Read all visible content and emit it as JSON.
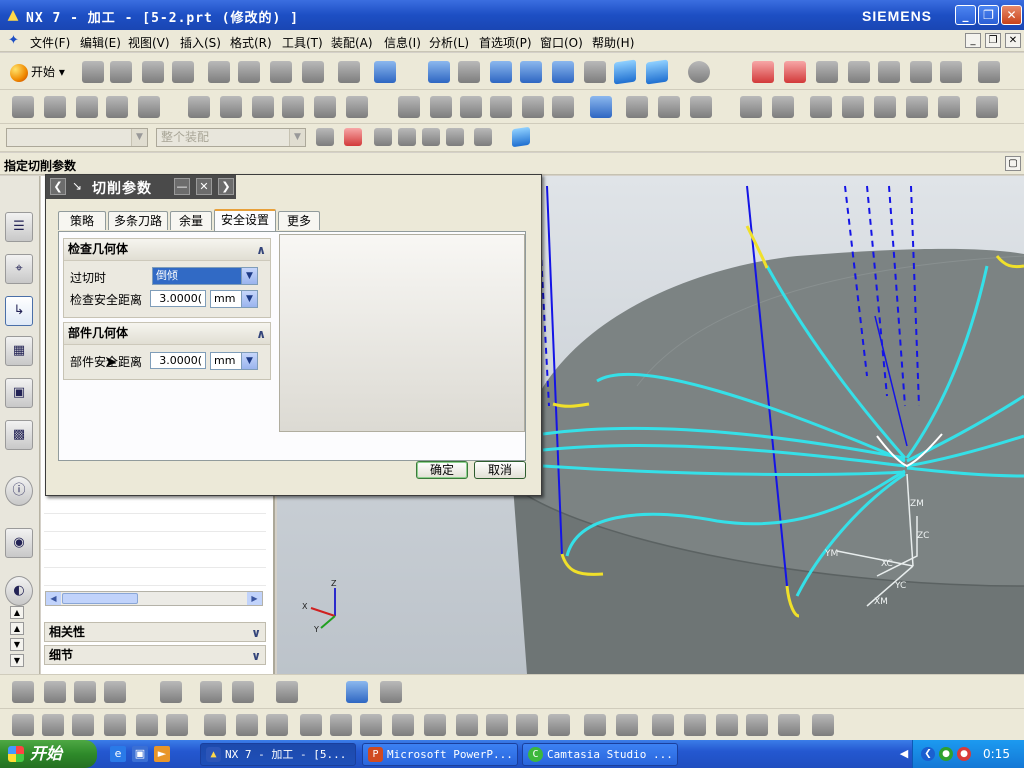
{
  "window": {
    "title": "NX 7 - 加工 - [5-2.prt (修改的) ]",
    "brand": "SIEMENS"
  },
  "menu": {
    "items": [
      "文件(F)",
      "编辑(E)",
      "视图(V)",
      "插入(S)",
      "格式(R)",
      "工具(T)",
      "装配(A)",
      "信息(I)",
      "分析(L)",
      "首选项(P)",
      "窗口(O)",
      "帮助(H)"
    ]
  },
  "toolbar": {
    "start_label": "开始",
    "filter_value": "",
    "assembly_filter": "整个装配"
  },
  "cue_line": "指定切削参数",
  "navigator": {
    "sections": [
      {
        "label": "相关性"
      },
      {
        "label": "细节"
      }
    ]
  },
  "dialog": {
    "title": "切削参数",
    "tabs": [
      "策略",
      "多条刀路",
      "余量",
      "安全设置",
      "更多"
    ],
    "active_tab": "安全设置",
    "groups": {
      "check_geometry": {
        "title": "检查几何体",
        "overcut_label": "过切时",
        "overcut_value": "倒倾",
        "check_clearance_label": "检查安全距离",
        "check_clearance_value": "3.0000(",
        "check_clearance_unit": "mm"
      },
      "part_geometry": {
        "title": "部件几何体",
        "part_clearance_label": "部件安全距离",
        "part_clearance_value": "3.0000(",
        "part_clearance_unit": "mm"
      }
    },
    "ok_label": "确定",
    "cancel_label": "取消"
  },
  "viewport": {
    "axis_labels": {
      "zm": "ZM",
      "xm": "XM",
      "ym": "YM",
      "zc": "ZC",
      "xc": "XC",
      "yc": "YC"
    },
    "triad_labels": {
      "z": "Z",
      "x": "X",
      "y": "Y"
    },
    "colors": {
      "part": "#7e8585",
      "toolpath": "#35e0e8",
      "approach": "#1a1aff",
      "retract": "#f0e02a"
    }
  },
  "taskbar": {
    "start_label": "开始",
    "tasks": [
      {
        "label": "NX 7 - 加工 - [5...",
        "icon": "nx-icon"
      },
      {
        "label": "Microsoft PowerP...",
        "icon": "powerpoint-icon"
      },
      {
        "label": "Camtasia Studio ...",
        "icon": "camtasia-icon"
      }
    ],
    "clock": "0:15"
  }
}
